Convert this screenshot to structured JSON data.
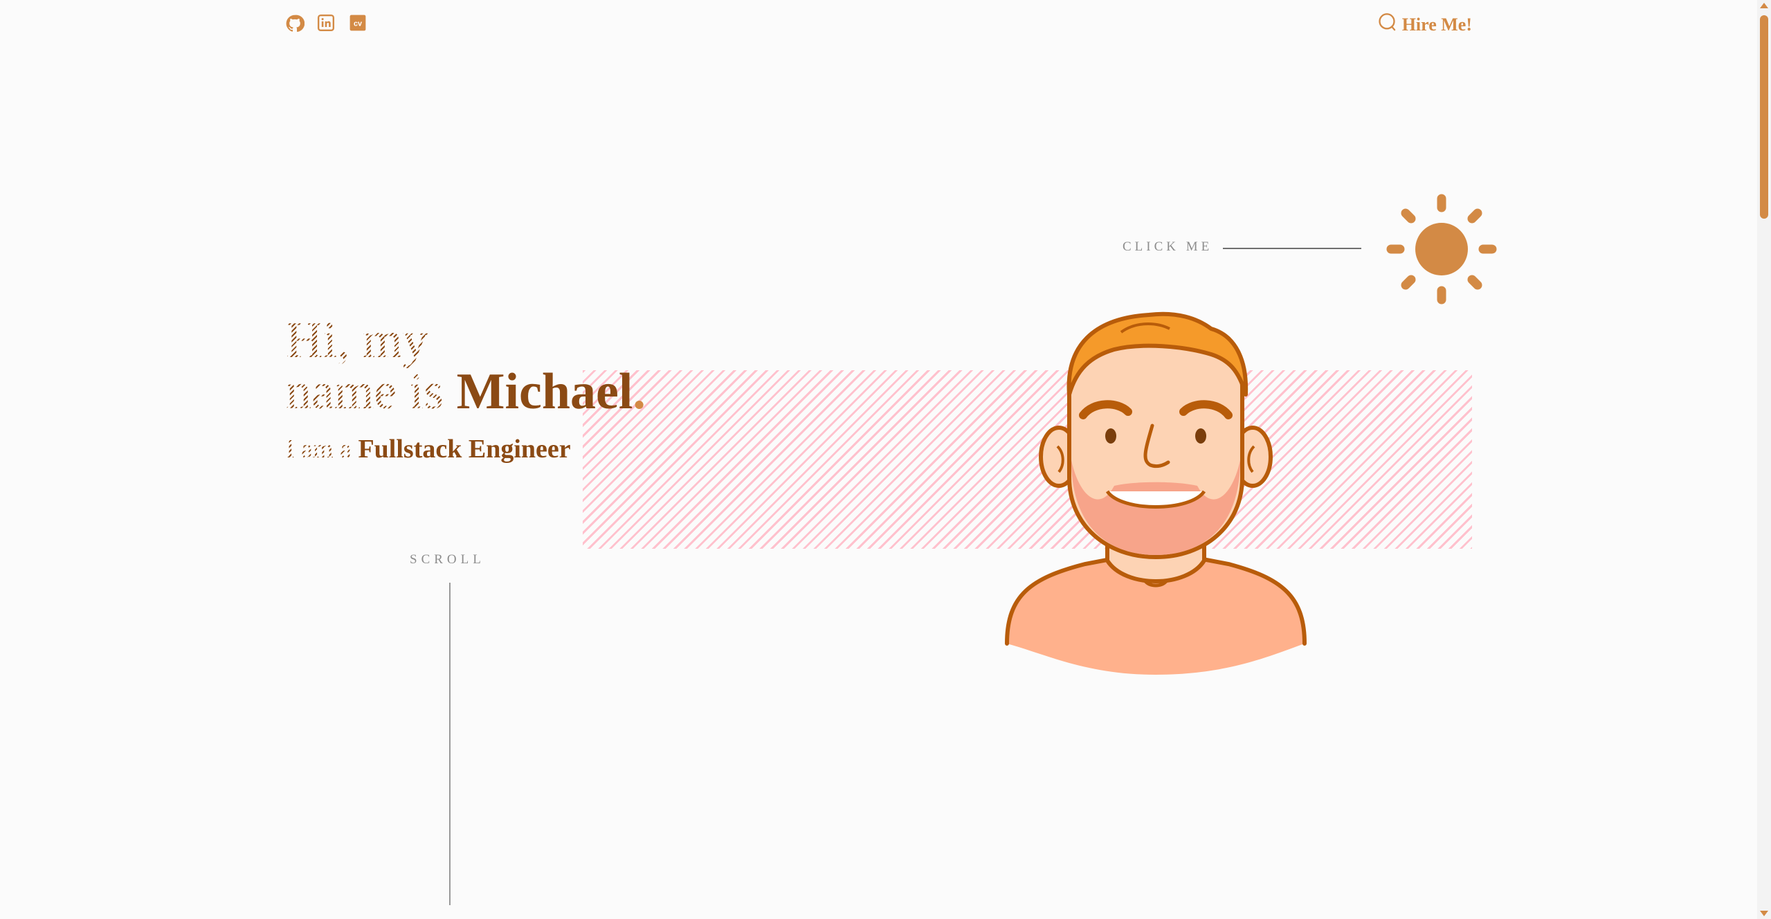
{
  "header": {
    "social": [
      {
        "name": "github-icon"
      },
      {
        "name": "linkedin-icon"
      },
      {
        "name": "cv-icon",
        "label": "cv"
      }
    ],
    "hire_label": "Hire Me!"
  },
  "theme": {
    "accent": "#d38a45",
    "brown": "#8b4a14",
    "pink": "#ffc1cd",
    "background": "#fbfbfb"
  },
  "toggle": {
    "click_label": "CLICK ME"
  },
  "hero": {
    "line1": "Hi, my",
    "line2_prefix": "name is ",
    "name": "Michael",
    "dot": ".",
    "sub_prefix": "I am a ",
    "role": "Fullstack Engineer"
  },
  "scroll": {
    "label": "SCROLL"
  }
}
